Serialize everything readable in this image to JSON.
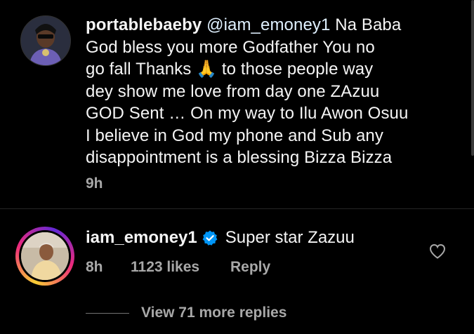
{
  "comment_1": {
    "username": "portablebaeby",
    "mention": "@iam_emoney1",
    "text_lines": [
      "Na Baba",
      "God bless you more Godfather You no",
      "go fall Thanks 🙏 to those people way",
      "dey show me love from day one ZAzuu",
      "GOD Sent … On my way to Ilu Awon Osuu",
      "I believe in God my phone and Sub any",
      "disappointment is a blessing Bizza Bizza"
    ],
    "time": "9h"
  },
  "comment_2": {
    "username": "iam_emoney1",
    "verified": true,
    "text": "Super star Zazuu",
    "time": "8h",
    "likes": "1123 likes",
    "reply_label": "Reply"
  },
  "view_replies": "View 71 more replies",
  "colors": {
    "background": "#000000",
    "primary_text": "#f5f5f5",
    "secondary_text": "#a8a8a8",
    "verified_badge": "#0095f6"
  }
}
